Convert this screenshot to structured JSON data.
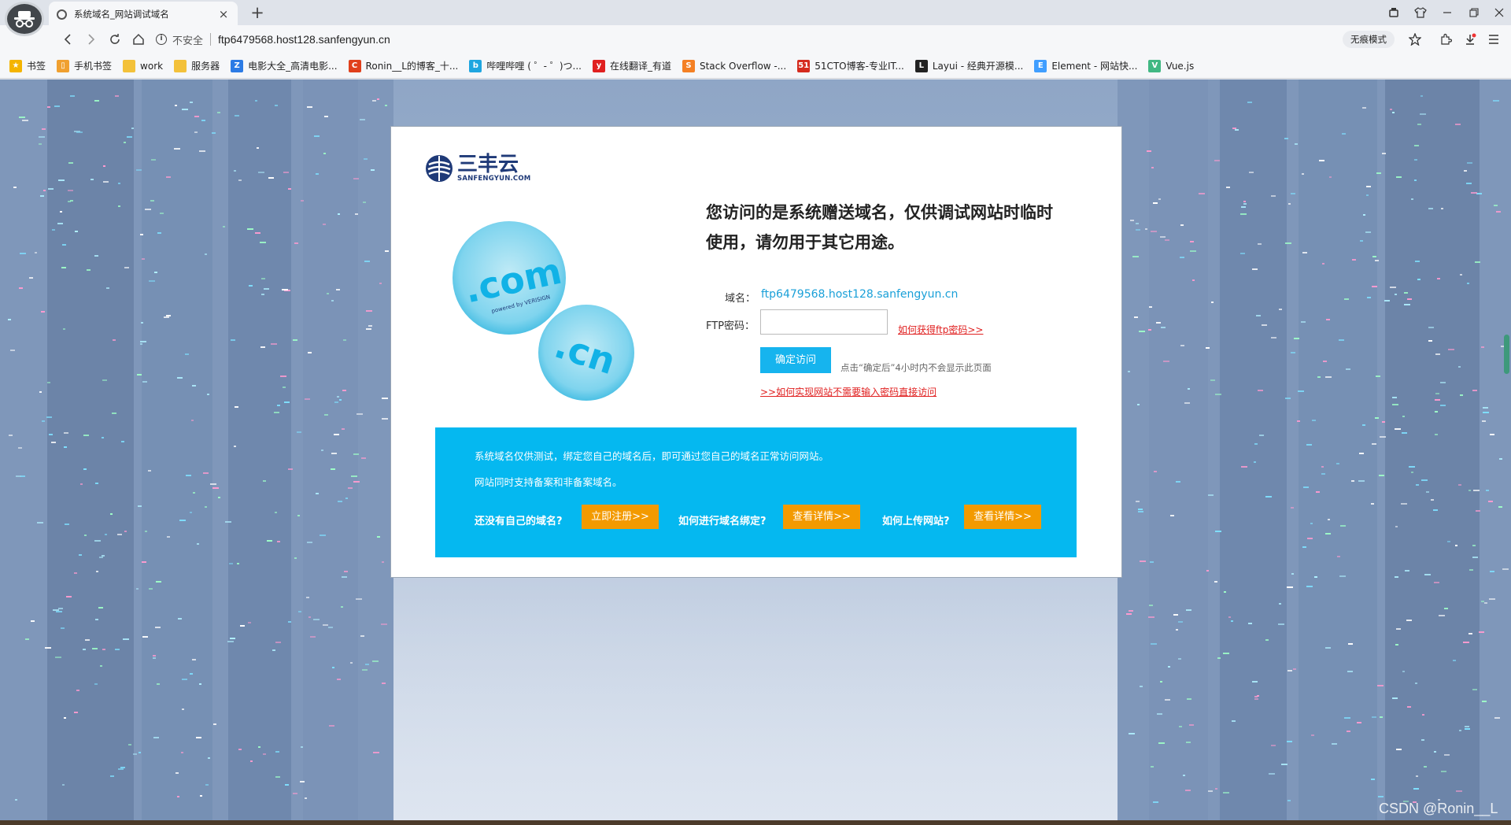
{
  "browser": {
    "tab_title": "系统域名_网站调试域名",
    "close_glyph": "×",
    "new_tab_glyph": "+",
    "insecure_label": "不安全",
    "url": "ftp6479568.host128.sanfengyun.cn",
    "incognito_label": "无痕模式",
    "bookmarks": [
      {
        "label": "书签",
        "icon": "star-icon",
        "color": "#f4b400"
      },
      {
        "label": "手机书签",
        "icon": "phone-bookmark-icon",
        "color": "#f0a030"
      },
      {
        "label": "work",
        "icon": "folder-icon",
        "color": "#f3c13a"
      },
      {
        "label": "服务器",
        "icon": "folder-icon",
        "color": "#f3c13a"
      },
      {
        "label": "电影大全_高清电影...",
        "icon": "movie-site-icon",
        "color": "#2c7be5"
      },
      {
        "label": "Ronin__L的博客_十...",
        "icon": "csdn-icon",
        "color": "#e0401c"
      },
      {
        "label": "哔哩哔哩 ( ゜- ゜)つ...",
        "icon": "bilibili-icon",
        "color": "#1fa6e0"
      },
      {
        "label": "在线翻译_有道",
        "icon": "youdao-icon",
        "color": "#e02020"
      },
      {
        "label": "Stack Overflow -...",
        "icon": "stackoverflow-icon",
        "color": "#f48024"
      },
      {
        "label": "51CTO博客-专业IT...",
        "icon": "51cto-icon",
        "color": "#d52b1e"
      },
      {
        "label": "Layui - 经典开源模...",
        "icon": "layui-icon",
        "color": "#222222"
      },
      {
        "label": "Element - 网站快...",
        "icon": "element-icon",
        "color": "#409eff"
      },
      {
        "label": "Vue.js",
        "icon": "vue-icon",
        "color": "#41b883"
      }
    ]
  },
  "card": {
    "logo_main": "三丰云",
    "logo_sub": "SANFENGYUN.COM",
    "headline": "您访问的是系统赠送域名，仅供调试网站时临时使用，请勿用于其它用途。",
    "badge_com": ".com",
    "badge_com_sub": "powered by VERISIGN",
    "badge_cn": ".cn",
    "domain_label": "域名：",
    "domain_value": "ftp6479568.host128.sanfengyun.cn",
    "ftp_label": "FTP密码：",
    "ftp_password_value": "",
    "ftp_help_link": "如何获得ftp密码>>",
    "confirm_button": "确定访问",
    "confirm_hint": "点击“确定后”4小时内不会显示此页面",
    "direct_access_link": ">>如何实现网站不需要输入密码直接访问"
  },
  "banner": {
    "line1": "系统域名仅供测试，绑定您自己的域名后，即可通过您自己的域名正常访问网站。",
    "line2": "网站同时支持备案和非备案域名。",
    "q1": "还没有自己的域名?",
    "btn1": "立即注册>>",
    "q2": "如何进行域名绑定?",
    "btn2": "查看详情>>",
    "q3": "如何上传网站?",
    "btn3": "查看详情>>"
  },
  "watermark": "CSDN @Ronin__L",
  "colors": {
    "banner": "#05b8f0",
    "orange_button": "#f39a00",
    "confirm_button": "#16b4ee",
    "link_red": "#e02020",
    "domain_blue": "#1aa0d8"
  }
}
